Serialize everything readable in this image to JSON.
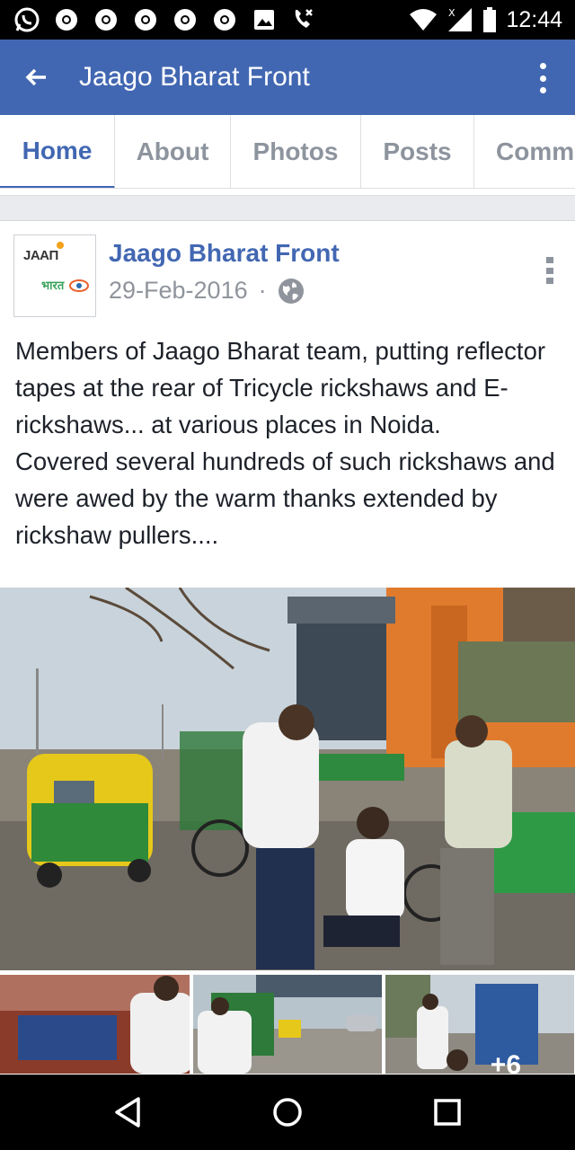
{
  "status_bar": {
    "time": "12:44"
  },
  "header": {
    "back_icon": "arrow-left-icon",
    "title": "Jaago Bharat Front",
    "menu_icon": "more-vertical-icon"
  },
  "tabs": [
    {
      "label": "Home",
      "active": true
    },
    {
      "label": "About",
      "active": false
    },
    {
      "label": "Photos",
      "active": false
    },
    {
      "label": "Posts",
      "active": false
    },
    {
      "label": "Comm",
      "active": false
    }
  ],
  "post": {
    "avatar_text_top": "JAAΠ",
    "avatar_text_bottom": "भारत",
    "author": "Jaago Bharat Front",
    "date": "29-Feb-2016",
    "separator": "·",
    "privacy_icon": "globe-icon",
    "text_lines": [
      "Members of Jaago Bharat team, putting reflector tapes at the rear of Tricycle rickshaws and E-rickshaws... at various places in Noida.",
      "Covered several hundreds of such rickshaws and were awed by the warm thanks extended by rickshaw pullers...."
    ],
    "more_photos": "+6"
  },
  "colors": {
    "brand": "#4267b2",
    "status_bar": "#000000",
    "text": "#1d2129",
    "muted": "#90949c"
  }
}
